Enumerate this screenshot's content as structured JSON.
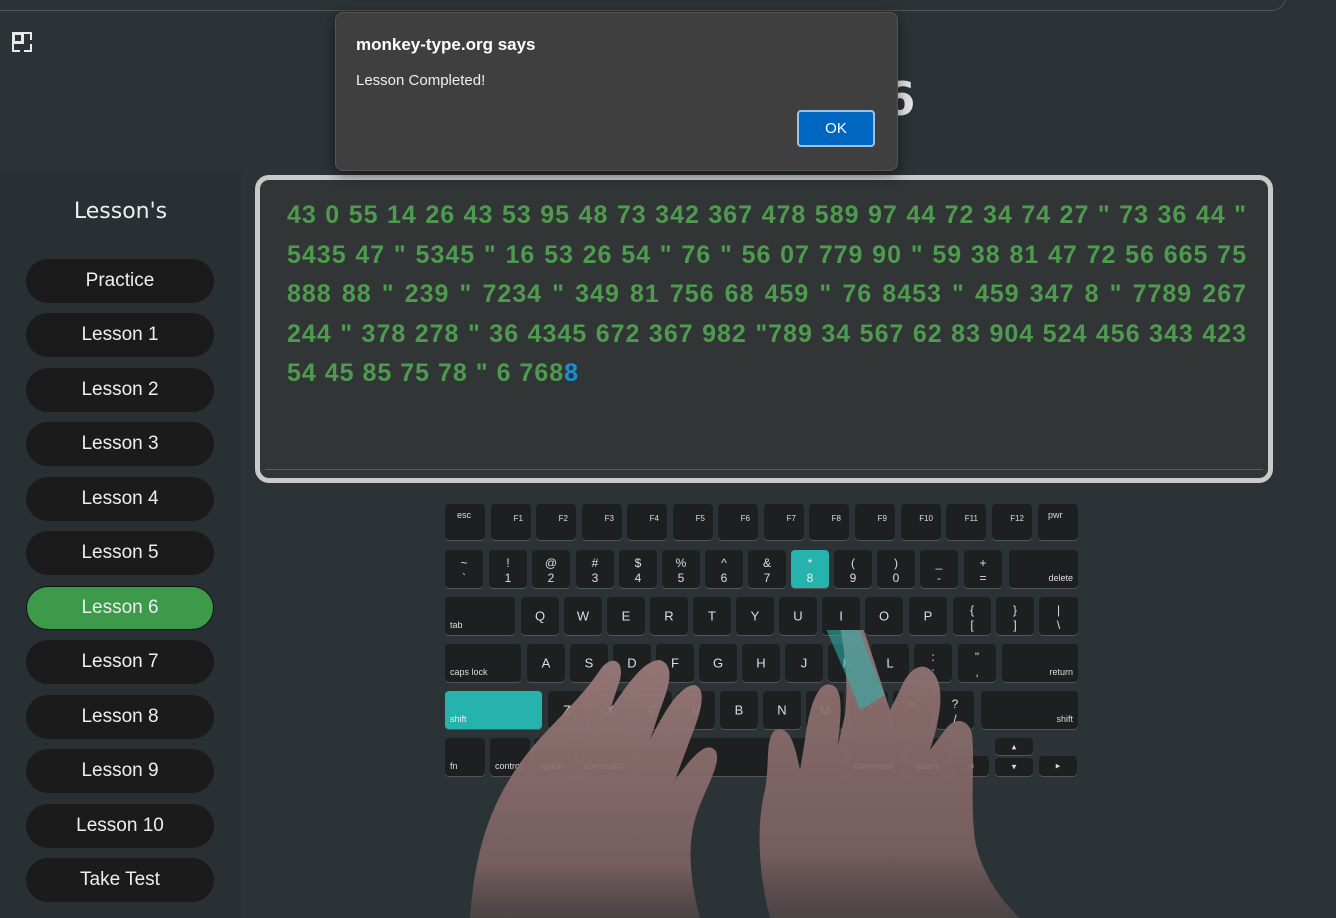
{
  "page": {
    "lesson_heading": "Lesson-6"
  },
  "sidebar": {
    "title": "Lesson's",
    "items": [
      {
        "label": "Practice"
      },
      {
        "label": "Lesson 1"
      },
      {
        "label": "Lesson 2"
      },
      {
        "label": "Lesson 3"
      },
      {
        "label": "Lesson 4"
      },
      {
        "label": "Lesson 5"
      },
      {
        "label": "Lesson 6",
        "active": true
      },
      {
        "label": "Lesson 7"
      },
      {
        "label": "Lesson 8"
      },
      {
        "label": "Lesson 9"
      },
      {
        "label": "Lesson 10"
      },
      {
        "label": "Take Test"
      }
    ]
  },
  "typing": {
    "typed_text": "43 0 55 14 26 43 53 95 48 73 342 367 478 589 97 44 72 34 74 27 \" 73 36 44 \" 5435 47 \" 5345 \" 16 53 26 54 \" 76 \" 56 07 779 90 \" 59 38 81 47 72 56 665 75 888 88 \" 239 \" 7234 \" 349 81 756 68 459 \" 76 8453 \" 459 347 8 \" 7789 267 244 \" 378 278 \" 36 4345 672 367 982 \"789 34 567 62 83 904 524 456 343 423 54 45 85 75 78 \" 6 768",
    "current_char": "8",
    "typed_color": "#4e9a4e",
    "current_color": "#1a8fd0"
  },
  "keyboard": {
    "highlight_color": "#26b3ad",
    "function_row": [
      "esc",
      "F1",
      "F2",
      "F3",
      "F4",
      "F5",
      "F6",
      "F7",
      "F8",
      "F9",
      "F10",
      "F11",
      "F12",
      "pwr"
    ],
    "number_row": [
      {
        "top": "~",
        "bot": "`"
      },
      {
        "top": "!",
        "bot": "1"
      },
      {
        "top": "@",
        "bot": "2"
      },
      {
        "top": "#",
        "bot": "3"
      },
      {
        "top": "$",
        "bot": "4"
      },
      {
        "top": "%",
        "bot": "5"
      },
      {
        "top": "^",
        "bot": "6"
      },
      {
        "top": "&",
        "bot": "7"
      },
      {
        "top": "*",
        "bot": "8",
        "highlight": true
      },
      {
        "top": "(",
        "bot": "9"
      },
      {
        "top": ")",
        "bot": "0"
      },
      {
        "top": "_",
        "bot": "-"
      },
      {
        "top": "+",
        "bot": "="
      }
    ],
    "delete": "delete",
    "tab": "tab",
    "qwerty_row": [
      "Q",
      "W",
      "E",
      "R",
      "T",
      "Y",
      "U",
      "I",
      "O",
      "P"
    ],
    "qwerty_sym": [
      {
        "top": "{",
        "bot": "["
      },
      {
        "top": "}",
        "bot": "]"
      },
      {
        "top": "|",
        "bot": "\\"
      }
    ],
    "caps": "caps lock",
    "home_row": [
      "A",
      "S",
      "D",
      "F",
      "G",
      "H",
      "J",
      "K",
      "L"
    ],
    "home_sym": [
      {
        "top": ":",
        "bot": ";"
      },
      {
        "top": "\"",
        "bot": ","
      }
    ],
    "return": "return",
    "shift_left": "shift",
    "bottom_letters": [
      "Z",
      "X",
      "C",
      "V",
      "B",
      "N",
      "M"
    ],
    "bottom_sym": [
      {
        "top": "<",
        "bot": ","
      },
      {
        "top": ">",
        "bot": "."
      },
      {
        "top": "?",
        "bot": "/"
      }
    ],
    "shift_right": "shift",
    "fn": "fn",
    "control": "control",
    "option": "option",
    "command": "command",
    "command_r": "command",
    "option_r": "option",
    "arrow_left": "◂",
    "arrow_up": "▴",
    "arrow_down": "▾",
    "arrow_right": "▸"
  },
  "dialog": {
    "title": "monkey-type.org says",
    "message": "Lesson Completed!",
    "ok_label": "OK"
  }
}
